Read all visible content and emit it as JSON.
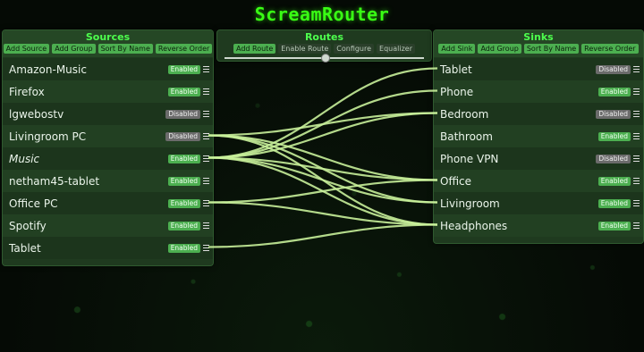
{
  "app": {
    "title": "ScreamRouter"
  },
  "sources": {
    "title": "Sources",
    "buttons": [
      "Add Source",
      "Add Group",
      "Sort By Name",
      "Reverse Order"
    ],
    "items": [
      {
        "name": "Amazon-Music",
        "status": "Enabled",
        "italic": false
      },
      {
        "name": "Firefox",
        "status": "Enabled",
        "italic": false
      },
      {
        "name": "lgwebostv",
        "status": "Disabled",
        "italic": false
      },
      {
        "name": "Livingroom PC",
        "status": "Disabled",
        "italic": false
      },
      {
        "name": "Music",
        "status": "Enabled",
        "italic": true
      },
      {
        "name": "netham45-tablet",
        "status": "Enabled",
        "italic": false
      },
      {
        "name": "Office PC",
        "status": "Enabled",
        "italic": false
      },
      {
        "name": "Spotify",
        "status": "Enabled",
        "italic": false
      },
      {
        "name": "Tablet",
        "status": "Enabled",
        "italic": false
      }
    ]
  },
  "routes": {
    "title": "Routes",
    "buttons": [
      {
        "label": "Add Route",
        "active": true
      },
      {
        "label": "Enable Route",
        "active": false
      },
      {
        "label": "Configure",
        "active": false
      },
      {
        "label": "Equalizer",
        "active": false
      }
    ]
  },
  "sinks": {
    "title": "Sinks",
    "buttons": [
      "Add Sink",
      "Add Group",
      "Sort By Name",
      "Reverse Order"
    ],
    "items": [
      {
        "name": "Tablet",
        "status": "Disabled"
      },
      {
        "name": "Phone",
        "status": "Enabled"
      },
      {
        "name": "Bedroom",
        "status": "Disabled"
      },
      {
        "name": "Bathroom",
        "status": "Enabled"
      },
      {
        "name": "Phone VPN",
        "status": "Disabled"
      },
      {
        "name": "Office",
        "status": "Enabled"
      },
      {
        "name": "Livingroom",
        "status": "Enabled"
      },
      {
        "name": "Headphones",
        "status": "Enabled"
      }
    ]
  },
  "connections": [
    {
      "source": "Livingroom PC",
      "sink": "Office"
    },
    {
      "source": "Livingroom PC",
      "sink": "Livingroom"
    },
    {
      "source": "Livingroom PC",
      "sink": "Headphones"
    },
    {
      "source": "Livingroom PC",
      "sink": "Bedroom"
    },
    {
      "source": "Music",
      "sink": "Tablet"
    },
    {
      "source": "Music",
      "sink": "Phone"
    },
    {
      "source": "Music",
      "sink": "Bedroom"
    },
    {
      "source": "Music",
      "sink": "Office"
    },
    {
      "source": "Music",
      "sink": "Livingroom"
    },
    {
      "source": "Music",
      "sink": "Headphones"
    },
    {
      "source": "Office PC",
      "sink": "Office"
    },
    {
      "source": "Office PC",
      "sink": "Headphones"
    },
    {
      "source": "Tablet",
      "sink": "Headphones"
    }
  ],
  "colors": {
    "accent": "#39ff14",
    "enabled": "#4caf50",
    "disabled": "#6b6b6b",
    "wire": "#c8f09a",
    "panel": "#1f3a1f"
  }
}
